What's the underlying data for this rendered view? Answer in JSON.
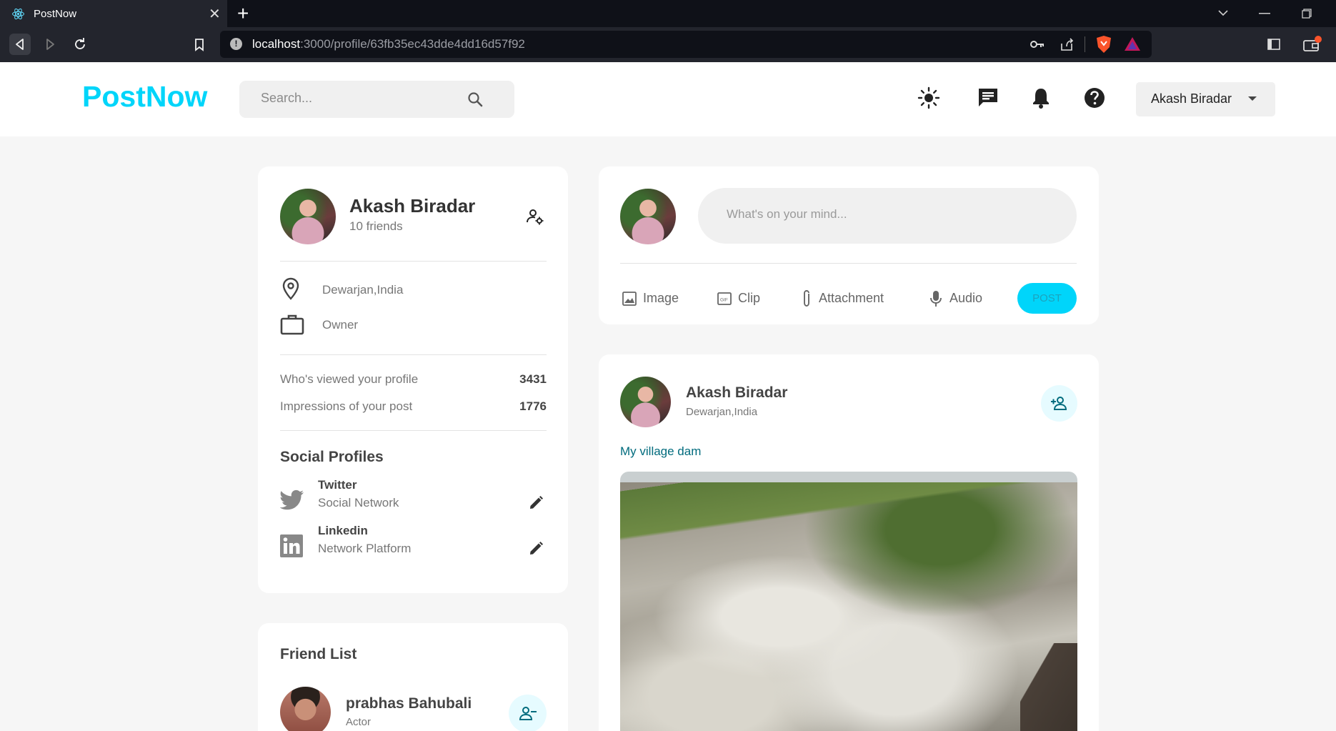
{
  "browser": {
    "tab_title": "PostNow",
    "url_host": "localhost",
    "url_path": ":3000/profile/63fb35ec43dde4dd16d57f92"
  },
  "header": {
    "logo": "PostNow",
    "search_placeholder": "Search...",
    "user_name": "Akash Biradar",
    "icons": [
      "light-mode-icon",
      "message-icon",
      "notifications-icon",
      "help-icon"
    ]
  },
  "profile": {
    "name": "Akash Biradar",
    "friends": "10 friends",
    "location": "Dewarjan,India",
    "occupation": "Owner",
    "stats": [
      {
        "label": "Who's viewed your profile",
        "value": "3431"
      },
      {
        "label": "Impressions of your post",
        "value": "1776"
      }
    ],
    "social_title": "Social Profiles",
    "socials": [
      {
        "name": "Twitter",
        "type": "Social Network",
        "icon": "twitter-icon"
      },
      {
        "name": "Linkedin",
        "type": "Network Platform",
        "icon": "linkedin-icon"
      }
    ]
  },
  "friend_list": {
    "title": "Friend List",
    "friends": [
      {
        "name": "prabhas Bahubali",
        "occupation": "Actor"
      }
    ]
  },
  "composer": {
    "placeholder": "What's on your mind...",
    "actions": [
      {
        "label": "Image",
        "icon": "image-icon"
      },
      {
        "label": "Clip",
        "icon": "gif-icon"
      },
      {
        "label": "Attachment",
        "icon": "attachment-icon"
      },
      {
        "label": "Audio",
        "icon": "microphone-icon"
      }
    ],
    "post_label": "POST"
  },
  "post": {
    "author": "Akash Biradar",
    "location": "Dewarjan,India",
    "description": "My village dam"
  },
  "colors": {
    "brand": "#00d5fa",
    "page_bg": "#f6f6f6",
    "card_bg": "#ffffff",
    "link_text": "#006b7d"
  }
}
